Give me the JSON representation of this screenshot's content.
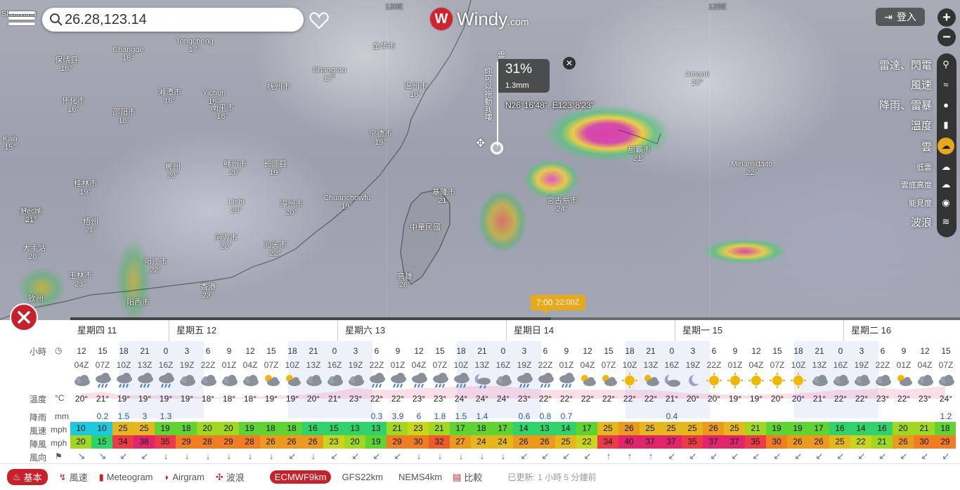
{
  "search": {
    "value": "26.28,123.14"
  },
  "logo": {
    "mark": "W",
    "name": "Windy",
    "domain": ".com"
  },
  "login": {
    "label": "登入"
  },
  "zoom": {
    "in": "+",
    "out": "−"
  },
  "map_labels": {
    "lon_120": "120E",
    "lon_125": "125E"
  },
  "cities": [
    {
      "name": "Shaoyang",
      "temp": ""
    },
    {
      "name": "Changde",
      "temp": "18°"
    },
    {
      "name": "Tongcheng",
      "temp": "17°"
    },
    {
      "name": "保靖县",
      "temp": "16°"
    },
    {
      "name": "Shangrao",
      "temp": "17°"
    },
    {
      "name": "金华市",
      "temp": ""
    },
    {
      "name": "湘潭市",
      "temp": "18°"
    },
    {
      "name": "Yichun",
      "temp": "18°"
    },
    {
      "name": "抚州市",
      "temp": ""
    },
    {
      "name": "温州市",
      "temp": "18°"
    },
    {
      "name": "怀化市",
      "temp": "16°"
    },
    {
      "name": "邵阳市",
      "temp": "18°"
    },
    {
      "name": "南平市",
      "temp": "18°"
    },
    {
      "name": "宁德市",
      "temp": "19°"
    },
    {
      "name": "Kaili",
      "temp": "15°"
    },
    {
      "name": "赣州市",
      "temp": "20°"
    },
    {
      "name": "长汀县",
      "temp": "19°"
    },
    {
      "name": "郴州",
      "temp": "20°"
    },
    {
      "name": "桂林市",
      "temp": "19°"
    },
    {
      "name": "Chuanchowfu",
      "temp": "19°"
    },
    {
      "name": "漳州市",
      "temp": "20°"
    },
    {
      "name": "贺州市",
      "temp": "21°"
    },
    {
      "name": "Lishi",
      "temp": "20°"
    },
    {
      "name": "Hechi",
      "temp": "21°"
    },
    {
      "name": "梧州",
      "temp": "21°"
    },
    {
      "name": "汕头市",
      "temp": "22°"
    },
    {
      "name": "河源市",
      "temp": "22°"
    },
    {
      "name": "大手站",
      "temp": "20°"
    },
    {
      "name": "阳江市",
      "temp": "22°"
    },
    {
      "name": "玉林市",
      "temp": "23°"
    },
    {
      "name": "香港",
      "temp": "23°"
    },
    {
      "name": "钦州",
      "temp": ""
    },
    {
      "name": "阳西市",
      "temp": ""
    },
    {
      "name": "基隆市",
      "temp": "21°"
    },
    {
      "name": "中華民國",
      "temp": ""
    },
    {
      "name": "高雄",
      "temp": "26°"
    },
    {
      "name": "宮古島市",
      "temp": "24°"
    },
    {
      "name": "Amami",
      "temp": "20°"
    },
    {
      "name": "那覇市",
      "temp": "21°"
    },
    {
      "name": "Minamidaito",
      "temp": "22°"
    }
  ],
  "popup": {
    "layer": "雲",
    "value": "31%",
    "sub": "1.3mm",
    "vertical_text": "你可以拖動我嘍",
    "coords": "N26°16'48\", E123°8'23\"",
    "close": "✕"
  },
  "layers": [
    {
      "label": "雷達、閃電",
      "icon": "radar-icon",
      "glyph": "⚲",
      "active": false,
      "size": "big"
    },
    {
      "label": "風速",
      "icon": "wind-icon",
      "glyph": "≈",
      "active": false,
      "size": "big"
    },
    {
      "label": "降雨、雷暴",
      "icon": "rain-drop-icon",
      "glyph": "●",
      "active": false,
      "size": "big"
    },
    {
      "label": "溫度",
      "icon": "thermometer-icon",
      "glyph": "▮",
      "active": false,
      "size": "big"
    },
    {
      "label": "雲",
      "icon": "cloud-icon",
      "glyph": "☁",
      "active": true,
      "size": "big"
    },
    {
      "label": "低雲",
      "icon": "low-cloud-icon",
      "glyph": "☁",
      "active": false,
      "size": "small"
    },
    {
      "label": "雲底高度",
      "icon": "cloud-base-icon",
      "glyph": "☁",
      "active": false,
      "size": "small"
    },
    {
      "label": "能見度",
      "icon": "eye-icon",
      "glyph": "◉",
      "active": false,
      "size": "small"
    },
    {
      "label": "波浪",
      "icon": "waves-icon",
      "glyph": "≋",
      "active": false,
      "size": "big"
    }
  ],
  "time_tag": {
    "local": "7:00",
    "utc": "22:00Z",
    "progress": 0.54
  },
  "forecast": {
    "days": [
      "星期四 11",
      "星期五 12",
      "星期六 13",
      "星期日 14",
      "星期一 15",
      "星期二 16"
    ],
    "row_labels": {
      "hours": "小時",
      "temp": "溫度",
      "temp_unit": "°C",
      "rain": "降雨",
      "rain_unit": "mm",
      "wind": "風速",
      "wind_unit": "mph",
      "gust": "陣風",
      "gust_unit": "mph",
      "dir": "風向"
    },
    "hours": [
      "12",
      "15",
      "18",
      "21",
      "0",
      "3",
      "6",
      "9",
      "12",
      "15",
      "18",
      "21",
      "0",
      "3",
      "6",
      "9",
      "12",
      "15",
      "18",
      "21",
      "0",
      "3",
      "6",
      "9",
      "12",
      "15",
      "18",
      "21",
      "0",
      "3",
      "6",
      "9",
      "12",
      "15",
      "18",
      "21",
      "0",
      "3",
      "6",
      "9",
      "12",
      "15"
    ],
    "zulu": [
      "04Z",
      "07Z",
      "10Z",
      "13Z",
      "16Z",
      "19Z",
      "22Z",
      "01Z",
      "04Z",
      "07Z",
      "10Z",
      "13Z",
      "16Z",
      "19Z",
      "22Z",
      "01Z",
      "04Z",
      "07Z",
      "10Z",
      "13Z",
      "16Z",
      "19Z",
      "22Z",
      "01Z",
      "04Z",
      "07Z",
      "10Z",
      "13Z",
      "16Z",
      "19Z",
      "22Z",
      "01Z",
      "04Z",
      "07Z",
      "10Z",
      "13Z",
      "16Z",
      "19Z",
      "22Z",
      "01Z",
      "04Z",
      "07Z"
    ],
    "icons": [
      "cloudy",
      "rain",
      "rain",
      "rain",
      "rain",
      "cloudy",
      "cloudy",
      "cloudy",
      "cloudy",
      "partly-sunny",
      "partly-sunny",
      "cloudy",
      "cloudy",
      "cloudy",
      "rain",
      "rain",
      "rain",
      "rain",
      "rain",
      "moon-rain",
      "cloudy",
      "rain",
      "rain",
      "rain",
      "partly-sunny",
      "partly-sunny",
      "sunny",
      "partly-sunny",
      "moon-cloud",
      "moon",
      "sunny",
      "sunny",
      "sunny",
      "sunny",
      "sunny",
      "cloudy",
      "cloudy",
      "cloudy",
      "cloudy",
      "partly-sunny",
      "cloudy",
      "cloudy"
    ],
    "temps": [
      "20°",
      "21°",
      "19°",
      "19°",
      "19°",
      "19°",
      "18°",
      "18°",
      "18°",
      "19°",
      "19°",
      "20°",
      "21°",
      "23°",
      "22°",
      "22°",
      "23°",
      "23°",
      "24°",
      "24°",
      "24°",
      "23°",
      "22°",
      "22°",
      "22°",
      "22°",
      "22°",
      "22°",
      "21°",
      "20°",
      "20°",
      "19°",
      "19°",
      "20°",
      "20°",
      "21°",
      "22°",
      "22°",
      "23°",
      "22°",
      "23°",
      "24°"
    ],
    "rain": [
      "",
      "0.2",
      "1.5",
      "3",
      "1.3",
      "",
      "",
      "",
      "",
      "",
      "",
      "",
      "",
      "",
      "0.3",
      "3.9",
      "6",
      "1.8",
      "1.5",
      "1.4",
      "",
      "0.6",
      "0.8",
      "0.7",
      "",
      "",
      "",
      "",
      "0.4",
      "",
      "",
      "",
      "",
      "",
      "",
      "",
      "",
      "",
      "",
      "",
      "",
      "1.2"
    ],
    "wind": [
      10,
      10,
      25,
      25,
      19,
      18,
      20,
      20,
      19,
      18,
      18,
      16,
      15,
      13,
      13,
      21,
      23,
      21,
      17,
      18,
      17,
      14,
      13,
      14,
      17,
      25,
      26,
      25,
      25,
      25,
      26,
      25,
      21,
      19,
      19,
      17,
      16,
      14,
      16,
      20,
      21,
      18
    ],
    "gust": [
      20,
      15,
      34,
      38,
      35,
      29,
      28,
      29,
      28,
      26,
      26,
      26,
      23,
      20,
      19,
      29,
      30,
      32,
      27,
      24,
      24,
      26,
      26,
      25,
      22,
      34,
      40,
      37,
      37,
      35,
      37,
      37,
      35,
      30,
      26,
      26,
      25,
      22,
      21,
      26,
      30,
      29
    ],
    "dir": [
      "↘",
      "↘",
      "↙",
      "↙",
      "↓",
      "↓",
      "↓",
      "↓",
      "↓",
      "↓",
      "↙",
      "↓",
      "↙",
      "↙",
      "↙",
      "↙",
      "↓",
      "↓",
      "↓",
      "↓",
      "↓",
      "↙",
      "↙",
      "↙",
      "↙",
      "↑",
      "↑",
      "↑",
      "↙",
      "↙",
      "↙",
      "↙",
      "↙",
      "↙",
      "↙",
      "↙",
      "↙",
      "↙",
      "↙",
      "↙",
      "↙",
      "↙"
    ]
  },
  "footer": {
    "tabs": [
      {
        "label": "基本",
        "icon": "basic-icon",
        "glyph": "♨",
        "active": true
      },
      {
        "label": "風速",
        "icon": "wind-icon",
        "glyph": "↯",
        "active": false
      },
      {
        "label": "Meteogram",
        "icon": "meteogram-icon",
        "glyph": "▮",
        "active": false
      },
      {
        "label": "Airgram",
        "icon": "airgram-icon",
        "glyph": "◗",
        "active": false
      },
      {
        "label": "波浪",
        "icon": "waves-icon",
        "glyph": "✣",
        "active": false
      }
    ],
    "models": [
      {
        "label": "ECMWF9km",
        "active": true
      },
      {
        "label": "GFS22km",
        "active": false
      },
      {
        "label": "NEMS4km",
        "active": false
      }
    ],
    "compare": "比較",
    "updated": "已更新: 1 小時 5 分鐘前"
  },
  "colors": {
    "accent": "#c8212b",
    "time_tag": "#e7a81b"
  }
}
